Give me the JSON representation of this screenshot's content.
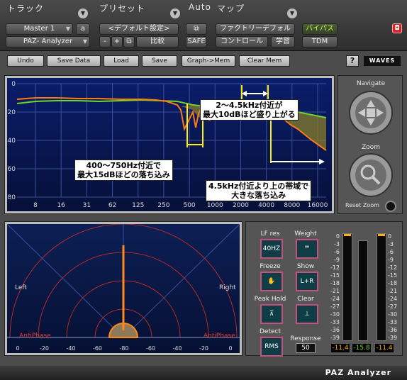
{
  "host": {
    "track_title": "トラック",
    "preset_title": "プリセット",
    "auto_title": "Auto",
    "map_title": "マップ",
    "track_name": "Master 1",
    "track_letter": "a",
    "plugin_name": "PAZ- Analyzer",
    "preset_name": "<デフォルト設定>",
    "minus": "-",
    "plus": "+",
    "compare": "比較",
    "safe": "SAFE",
    "map_value": "ファクトリーデフォル",
    "control": "コントロール",
    "learn": "学習",
    "bypass": "バイパス",
    "tdm": "TDM"
  },
  "toolbar": {
    "undo": "Undo",
    "save_data": "Save Data",
    "load": "Load",
    "save": "Save",
    "graph_mem": "Graph->Mem",
    "clear_mem": "Clear Mem",
    "help": "?",
    "logo": "WAVES"
  },
  "spectrum": {
    "db_labels": [
      "0",
      "-20",
      "-40",
      "-60",
      "-80"
    ],
    "freq_labels": [
      "8",
      "16",
      "31",
      "62",
      "125",
      "250",
      "500",
      "1000",
      "2000",
      "4000",
      "8000",
      "16000"
    ],
    "annotations": {
      "top": [
        "2〜4.5kHz付近が",
        "最大10dBほど盛り上がる"
      ],
      "left": [
        "400〜750Hz付近で",
        "最大15dBほどの落ち込み"
      ],
      "right": [
        "4.5kHz付近より上の帯域で",
        "大きな落ち込み"
      ]
    }
  },
  "navigate": {
    "navigate_label": "Navigate",
    "zoom_label": "Zoom",
    "reset_label": "Reset Zoom"
  },
  "phase": {
    "left": "Left",
    "right": "Right",
    "antiphase_left": "AntiPhase",
    "antiphase_right": "AntiPhase",
    "scale": [
      "0",
      "-20",
      "-40",
      "-60",
      "-80",
      "-60",
      "-40",
      "-20",
      "0"
    ]
  },
  "controls": {
    "lf_res": "LF res",
    "lf_res_value": "40HZ",
    "weight": "Weight",
    "freeze": "Freeze",
    "show": "Show",
    "show_value": "L+R",
    "peak_hold": "Peak Hold",
    "clear": "Clear",
    "detect": "Detect",
    "detect_value": "RMS",
    "response": "Response",
    "response_value": "50"
  },
  "meters": {
    "scale": [
      "0",
      "-3",
      "-6",
      "-9",
      "-12",
      "-15",
      "-18",
      "-21",
      "-24",
      "-27",
      "-30",
      "-33",
      "-36",
      "-39"
    ],
    "left_value": "-11.4",
    "center_value": "-15.8",
    "right_value": "-11.4",
    "peak_color": "#ffb000",
    "rms_color": "#7ddc2c"
  },
  "status": {
    "name": "PAZ Analyzer"
  }
}
